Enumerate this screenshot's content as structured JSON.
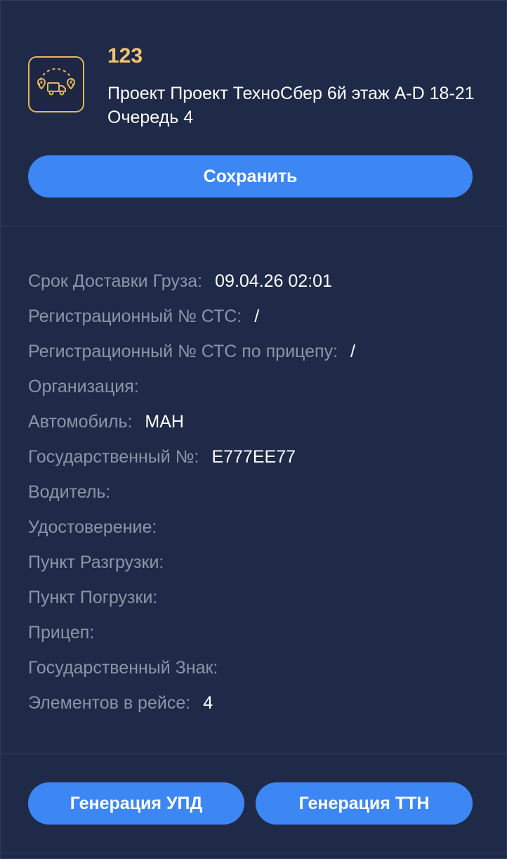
{
  "header": {
    "order_number": "123",
    "project_name": "Проект Проект ТехноСбер 6й этаж A-D 18-21 Очередь 4",
    "logo_icon": "delivery-route-icon",
    "accent_color": "#f2c46d"
  },
  "actions": {
    "save_label": "Сохранить",
    "generate_upd_label": "Генерация УПД",
    "generate_ttn_label": "Генерация ТТН",
    "button_color": "#3d87f5"
  },
  "details": [
    {
      "label": "Срок Доставки Груза:",
      "value": "09.04.26 02:01"
    },
    {
      "label": "Регистрационный № СТС:",
      "value": "/"
    },
    {
      "label": "Регистрационный № СТС по прицепу:",
      "value": "/"
    },
    {
      "label": "Организация:",
      "value": ""
    },
    {
      "label": "Автомобиль:",
      "value": "МАН"
    },
    {
      "label": "Государственный №:",
      "value": "Е777ЕЕ77"
    },
    {
      "label": "Водитель:",
      "value": ""
    },
    {
      "label": "Удостоверение:",
      "value": ""
    },
    {
      "label": "Пункт Разгрузки:",
      "value": ""
    },
    {
      "label": "Пункт Погрузки:",
      "value": ""
    },
    {
      "label": "Прицеп:",
      "value": ""
    },
    {
      "label": "Государственный Знак:",
      "value": ""
    },
    {
      "label": "Элементов в рейсе:",
      "value": "4"
    }
  ]
}
